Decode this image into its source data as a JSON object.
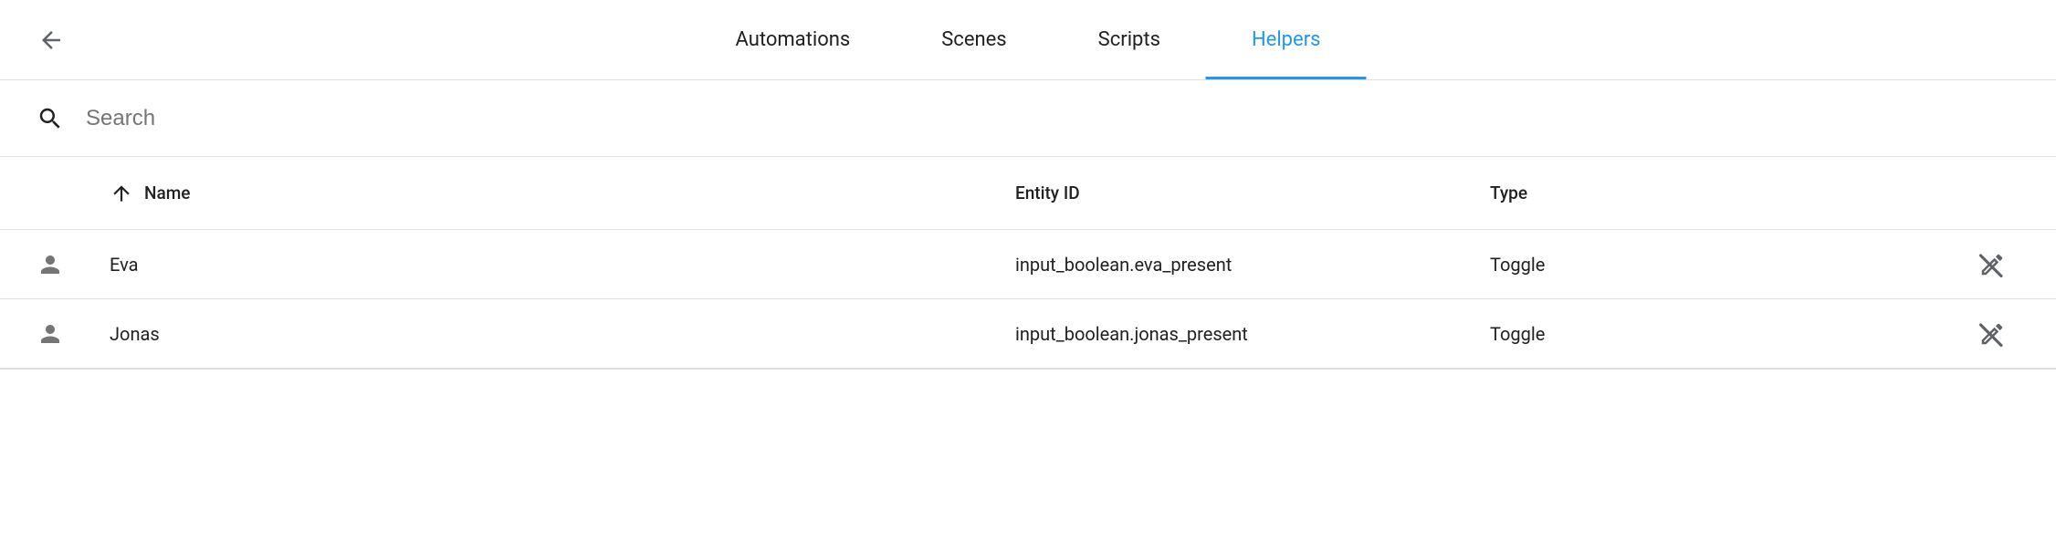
{
  "header": {
    "tabs": [
      {
        "label": "Automations",
        "active": false
      },
      {
        "label": "Scenes",
        "active": false
      },
      {
        "label": "Scripts",
        "active": false
      },
      {
        "label": "Helpers",
        "active": true
      }
    ]
  },
  "search": {
    "placeholder": "Search"
  },
  "table": {
    "columns": {
      "name": "Name",
      "entity_id": "Entity ID",
      "type": "Type"
    },
    "rows": [
      {
        "name": "Eva",
        "entity_id": "input_boolean.eva_present",
        "type": "Toggle"
      },
      {
        "name": "Jonas",
        "entity_id": "input_boolean.jonas_present",
        "type": "Toggle"
      }
    ]
  }
}
